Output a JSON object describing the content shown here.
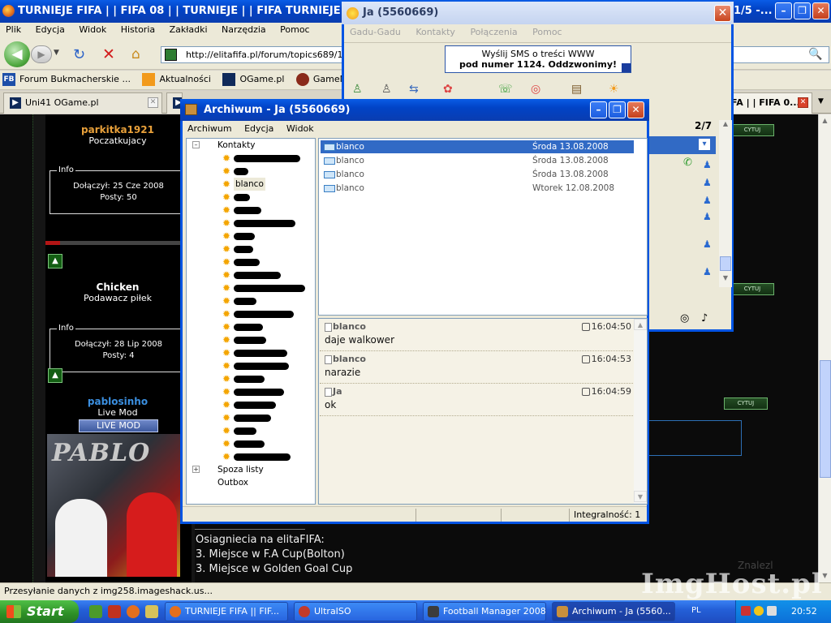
{
  "browser": {
    "title": "TURNIEJE FIFA | | FIFA 08 | | TURNIEJE | | FIFA TURNIEJE | | GR",
    "title_right": "1/5 -...",
    "menu": [
      "Plik",
      "Edycja",
      "Widok",
      "Historia",
      "Zakładki",
      "Narzędzia",
      "Pomoc"
    ],
    "url": "http://elitafifa.pl/forum/topics689/1-5-v",
    "bookmarks": [
      {
        "label": "Forum Bukmacherskie ...",
        "icon": "FB"
      },
      {
        "label": "Aktualności",
        "icon": "rss-icon"
      },
      {
        "label": "OGame.pl",
        "icon": "ogame-icon"
      },
      {
        "label": "GameMania :: Stron",
        "icon": "gamemania-icon"
      }
    ],
    "tabs": [
      {
        "label": "Uni41 OGame.pl"
      },
      {
        "label": "FA | | FIFA 0..."
      }
    ],
    "status": "Przesyłanie danych z img258.imageshack.us..."
  },
  "forum": {
    "posts": [
      {
        "username": "parkitka1921",
        "rank": "Poczatkujacy",
        "info_legend": "Info",
        "joined": "Dołączył: 25 Cze 2008",
        "posts": "Posty: 50"
      },
      {
        "username": "Chicken",
        "rank": "Podawacz piłek",
        "info_legend": "Info",
        "joined": "Dołączył: 28 Lip 2008",
        "posts": "Posty: 4"
      },
      {
        "username": "pablosinho",
        "rank": "Live Mod",
        "badge": "LIVE MOD",
        "avatar_text": "PABLO"
      }
    ],
    "quote_label": "CYTUJ",
    "signature_lines": [
      "Osiagniecia na elitaFIFA:",
      "3. Miejsce w F.A Cup(Bolton)",
      "3. Miejsce w Golden Goal Cup"
    ],
    "watermark": "ImgHost.pl",
    "watermark_left": "Znalezl"
  },
  "gg_main": {
    "title": "Ja (5560669)",
    "menu": [
      "Gadu-Gadu",
      "Kontakty",
      "Połączenia",
      "Pomoc"
    ],
    "sms_line1": "Wyślij SMS o treści WWW",
    "sms_line2": "pod numer 1124. Oddzwonimy!",
    "page_count": "2/7"
  },
  "archiwum": {
    "title": "Archiwum - Ja (5560669)",
    "menu": [
      "Archiwum",
      "Edycja",
      "Widok"
    ],
    "tree": {
      "root": "Kontakty",
      "visible_contact": "blanco",
      "other_groups": [
        "Spoza listy",
        "Outbox"
      ]
    },
    "messages": [
      {
        "from": "blanco",
        "date": "Środa 13.08.2008",
        "selected": true
      },
      {
        "from": "blanco",
        "date": "Środa 13.08.2008",
        "selected": false
      },
      {
        "from": "blanco",
        "date": "Środa 13.08.2008",
        "selected": false
      },
      {
        "from": "blanco",
        "date": "Wtorek 12.08.2008",
        "selected": false
      }
    ],
    "conversation": [
      {
        "author": "blanco",
        "time": "16:04:50",
        "text": "daje walkower"
      },
      {
        "author": "blanco",
        "time": "16:04:53",
        "text": "narazie"
      },
      {
        "author": "Ja",
        "time": "16:04:59",
        "text": "ok"
      }
    ],
    "status": "Integralność: 1"
  },
  "taskbar": {
    "start_label": "Start",
    "tasks": [
      {
        "label": "TURNIEJE FIFA || FIF..."
      },
      {
        "label": "UltraISO"
      },
      {
        "label": "Football Manager 2008"
      },
      {
        "label": "Archiwum - Ja (5560..."
      }
    ],
    "language": "PL",
    "clock": "20:52"
  }
}
